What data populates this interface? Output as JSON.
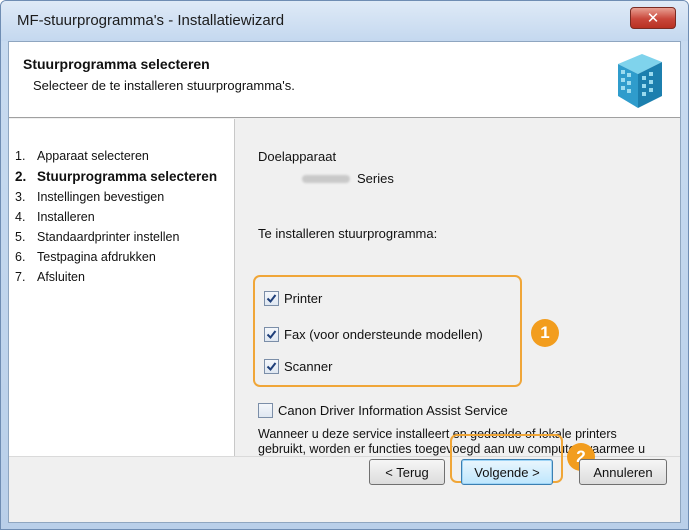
{
  "window": {
    "title": "MF-stuurprogramma's - Installatiewizard",
    "close_glyph": "✕"
  },
  "header": {
    "title": "Stuurprogramma selecteren",
    "subtitle": "Selecteer de te installeren stuurprogramma's."
  },
  "steps": [
    {
      "num": "1.",
      "label": "Apparaat selecteren",
      "active": false
    },
    {
      "num": "2.",
      "label": "Stuurprogramma selecteren",
      "active": true
    },
    {
      "num": "3.",
      "label": "Instellingen bevestigen",
      "active": false
    },
    {
      "num": "4.",
      "label": "Installeren",
      "active": false
    },
    {
      "num": "5.",
      "label": "Standaardprinter instellen",
      "active": false
    },
    {
      "num": "6.",
      "label": "Testpagina afdrukken",
      "active": false
    },
    {
      "num": "7.",
      "label": "Afsluiten",
      "active": false
    }
  ],
  "main": {
    "target_label": "Doelapparaat",
    "target_value": "Series",
    "drivers_label": "Te installeren stuurprogramma:",
    "drivers": [
      {
        "label": "Printer",
        "checked": true
      },
      {
        "label": "Fax (voor ondersteunde modellen)",
        "checked": true
      },
      {
        "label": "Scanner",
        "checked": true
      }
    ],
    "service": {
      "label": "Canon Driver Information Assist Service",
      "checked": false,
      "description": "Wanneer u deze service installeert en gedeelde of lokale printers gebruikt, worden er functies toegevoegd aan uw computer waarmee u apparaatgegevens kunt ophalen."
    }
  },
  "callouts": {
    "one": "1",
    "two": "2"
  },
  "footer": {
    "back": "< Terug",
    "next": "Volgende >",
    "cancel": "Annuleren"
  },
  "colors": {
    "callout": "#f29d1e",
    "titlebar": "#c4d8ef",
    "close": "#c9463a"
  }
}
